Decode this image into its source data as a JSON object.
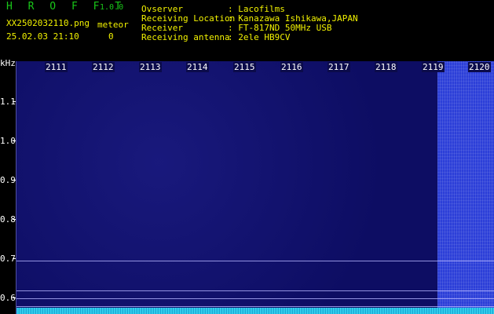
{
  "app": {
    "name": "H R O F F T",
    "version": "1.0.0"
  },
  "capture": {
    "filename": "XX2502032110.png",
    "timestamp": "25.02.03 21:10"
  },
  "meteor": {
    "label": "meteor",
    "count": "0"
  },
  "station": {
    "observer_key": "Ovserver",
    "observer_val": ": Lacofilms",
    "location_key": "Receiving Location",
    "location_val": ": Kanazawa Ishikawa,JAPAN",
    "receiver_key": "Receiver",
    "receiver_val": ": FT-817ND 50MHz USB",
    "antenna_key": "Receiving antenna",
    "antenna_val": ": 2ele HB9CV"
  },
  "axis": {
    "unit": "kHz",
    "freq_ticks": [
      "1.1",
      "1.0",
      "0.9",
      "0.8",
      "0.7",
      "0.6"
    ],
    "time_ticks": [
      "2111",
      "2112",
      "2113",
      "2114",
      "2115",
      "2116",
      "2117",
      "2118",
      "2119",
      "2120"
    ]
  },
  "colors": {
    "header_green": "#19c619",
    "header_yellow": "#f2f200",
    "waterfall_bg": "#0d0d63"
  }
}
